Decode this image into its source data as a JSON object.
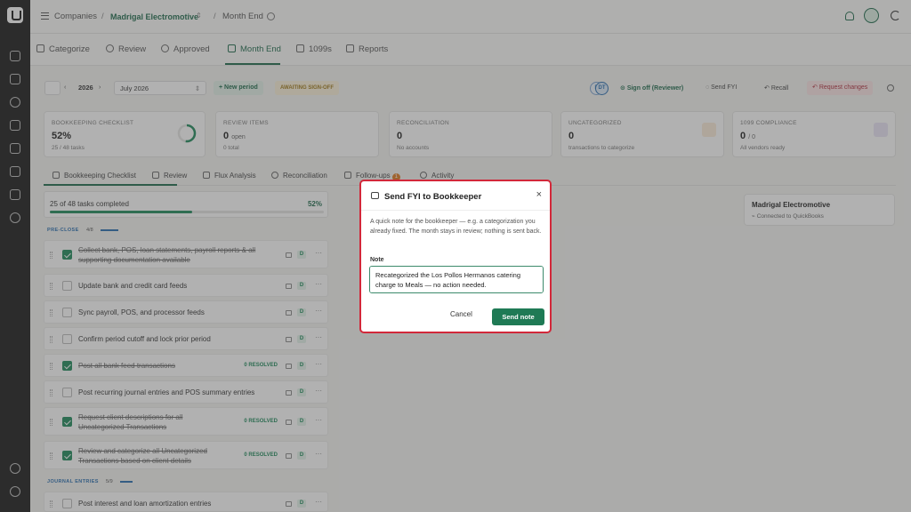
{
  "breadcrumb": {
    "root": "Companies",
    "company": "Madrigal Electromotive",
    "page": "Month End"
  },
  "nav_tabs": [
    "Categorize",
    "Review",
    "Approved",
    "Month End",
    "1099s",
    "Reports"
  ],
  "period": {
    "year": "2026",
    "month": "July 2026",
    "new_period": "+ New period",
    "status": "AWAITING SIGN-OFF",
    "avatar_initials": [
      "D",
      "DT"
    ]
  },
  "actions": {
    "sign_off": "Sign off (Reviewer)",
    "send_fyi": "Send FYI",
    "recall": "Recall",
    "request_changes": "Request changes"
  },
  "stats": [
    {
      "label": "BOOKKEEPING CHECKLIST",
      "value": "52%",
      "unit": "",
      "sub": "25 / 48 tasks"
    },
    {
      "label": "REVIEW ITEMS",
      "value": "0",
      "unit": "open",
      "sub": "0 total"
    },
    {
      "label": "RECONCILIATION",
      "value": "0",
      "unit": "",
      "sub": "No accounts"
    },
    {
      "label": "UNCATEGORIZED",
      "value": "0",
      "unit": "",
      "sub": "transactions to categorize"
    },
    {
      "label": "1099 COMPLIANCE",
      "value": "0",
      "unit": "/ 0",
      "sub": "All vendors ready"
    }
  ],
  "checklist_progress": 0.52,
  "sub_tabs": [
    "Bookkeeping Checklist",
    "Review",
    "Flux Analysis",
    "Reconciliation",
    "Follow-ups",
    "Activity"
  ],
  "followups_badge": "1",
  "checklist": {
    "summary": "25 of 48 tasks completed",
    "percent": "52%",
    "sections": [
      {
        "label": "PRE-CLOSE",
        "count": "4/8"
      },
      {
        "label": "JOURNAL ENTRIES",
        "count": "5/9"
      }
    ],
    "rows": [
      {
        "text": "Collect bank, POS, loan statements, payroll reports & all supporting documentation available",
        "done": true,
        "resolved": ""
      },
      {
        "text": "Update bank and credit card feeds",
        "done": false,
        "resolved": ""
      },
      {
        "text": "Sync payroll, POS, and processor feeds",
        "done": false,
        "resolved": ""
      },
      {
        "text": "Confirm period cutoff and lock prior period",
        "done": false,
        "resolved": ""
      },
      {
        "text": "Post all bank feed transactions",
        "done": true,
        "resolved": "0 RESOLVED"
      },
      {
        "text": "Post recurring journal entries and POS summary entries",
        "done": false,
        "resolved": ""
      },
      {
        "text": "Request client descriptions for all Uncategorized Transactions",
        "done": true,
        "resolved": "0 RESOLVED"
      },
      {
        "text": "Review and categorize all Uncategorized Transactions based on client details",
        "done": true,
        "resolved": "0 RESOLVED"
      },
      {
        "text": "Post interest and loan amortization entries",
        "done": false,
        "resolved": ""
      }
    ],
    "row_badge": "D",
    "more": "···"
  },
  "company_card": {
    "name": "Madrigal Electromotive",
    "status": "Connected to QuickBooks"
  },
  "modal": {
    "title": "Send FYI to Bookkeeper",
    "description": "A quick note for the bookkeeper — e.g. a categorization you already fixed. The month stays in review; nothing is sent back.",
    "note_label": "Note",
    "note_value": "Recategorized the Los Pollos Hermanos catering charge to Meals — no action needed.",
    "cancel": "Cancel",
    "send": "Send note",
    "close": "×"
  },
  "colors": {
    "accent": "#1f7a55",
    "modal_border": "#d2283a",
    "status": "#a07a1a"
  }
}
